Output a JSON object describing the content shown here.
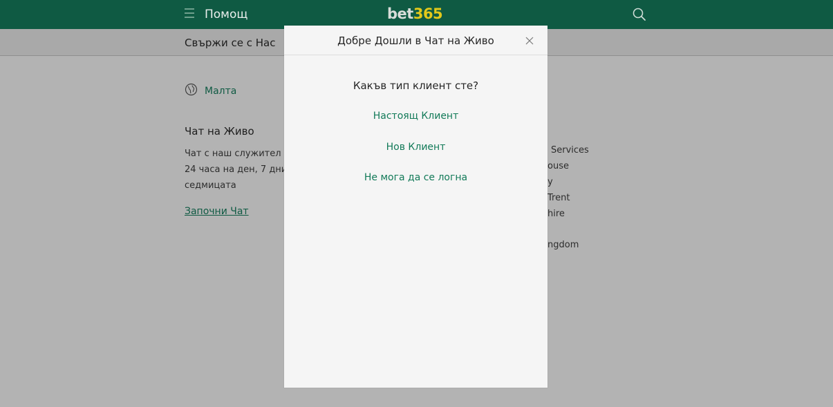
{
  "header": {
    "title": "Помощ",
    "logo": {
      "bet": "bet",
      "num": "365"
    },
    "icons": {
      "menu": "menu-icon",
      "search": "search-icon"
    }
  },
  "subbar": {
    "title": "Свържи се с Нас"
  },
  "location": {
    "label": "Малта",
    "icon": "globe-icon"
  },
  "chat": {
    "heading": "Чат на Живо",
    "description": "Чат с наш служител 24 часа на ден, 7 дни седмицата",
    "link": "Започни Чат"
  },
  "address_fragments": [
    "Services",
    "ouse",
    "y",
    "Trent",
    "hire",
    "ngdom"
  ],
  "modal": {
    "title": "Добре Дошли в Чат на Живо",
    "question": "Какъв тип клиент сте?",
    "options": [
      "Настоящ Клиент",
      "Нов Клиент",
      "Не мога да се логна"
    ]
  },
  "colors": {
    "header_bg": "#0f5a43",
    "logo_accent": "#e3c91a",
    "link_green": "#127a58",
    "page_bg": "#b3b3b3",
    "modal_bg": "#f5f5f5"
  }
}
